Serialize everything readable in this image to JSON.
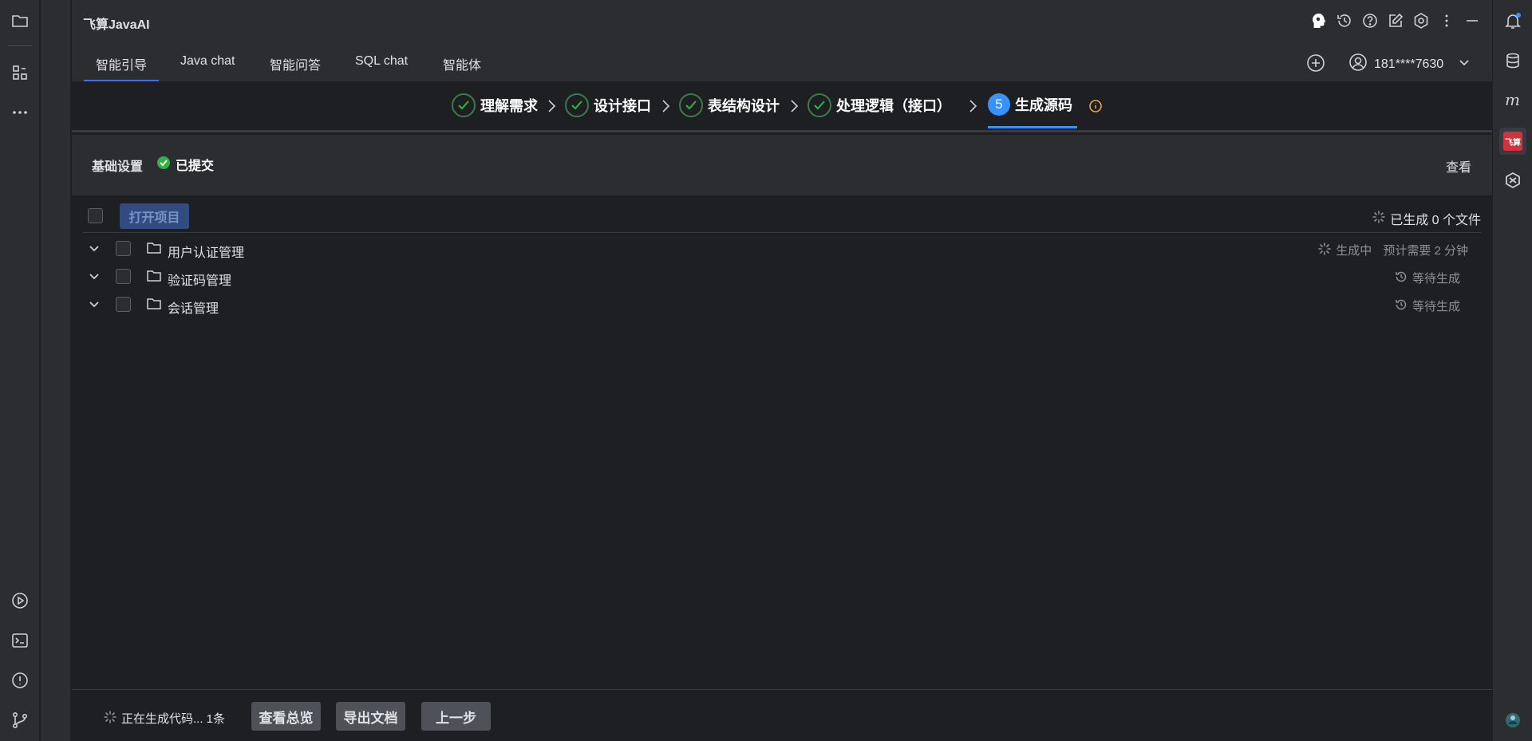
{
  "app": {
    "title": "飞算JavaAI"
  },
  "tabs": [
    {
      "label": "智能引导"
    },
    {
      "label": "Java chat"
    },
    {
      "label": "智能问答"
    },
    {
      "label": "SQL chat"
    },
    {
      "label": "智能体"
    }
  ],
  "user": {
    "name": "181****7630"
  },
  "steps": [
    {
      "label": "理解需求",
      "state": "done"
    },
    {
      "label": "设计接口",
      "state": "done"
    },
    {
      "label": "表结构设计",
      "state": "done"
    },
    {
      "label": "处理逻辑（接口）",
      "state": "done"
    },
    {
      "label": "生成源码",
      "state": "active",
      "number": "5"
    }
  ],
  "basic": {
    "title": "基础设置",
    "status": "已提交",
    "view_label": "查看"
  },
  "toolbar": {
    "open_project_label": "打开项目",
    "generated_count": "已生成 0 个文件"
  },
  "tree": [
    {
      "name": "用户认证管理",
      "status": "生成中",
      "estimate": "预计需要 2 分钟"
    },
    {
      "name": "验证码管理",
      "status": "等待生成"
    },
    {
      "name": "会话管理",
      "status": "等待生成"
    }
  ],
  "footer": {
    "status": "正在生成代码... 1条",
    "overview_label": "查看总览",
    "export_label": "导出文档",
    "prev_label": "上一步"
  },
  "right_bar": {
    "badge_label": "飞算"
  },
  "colors": {
    "accent": "#3574f0",
    "step_active": "#3592ff",
    "success": "#2fb344",
    "warning": "#e8a33c"
  }
}
